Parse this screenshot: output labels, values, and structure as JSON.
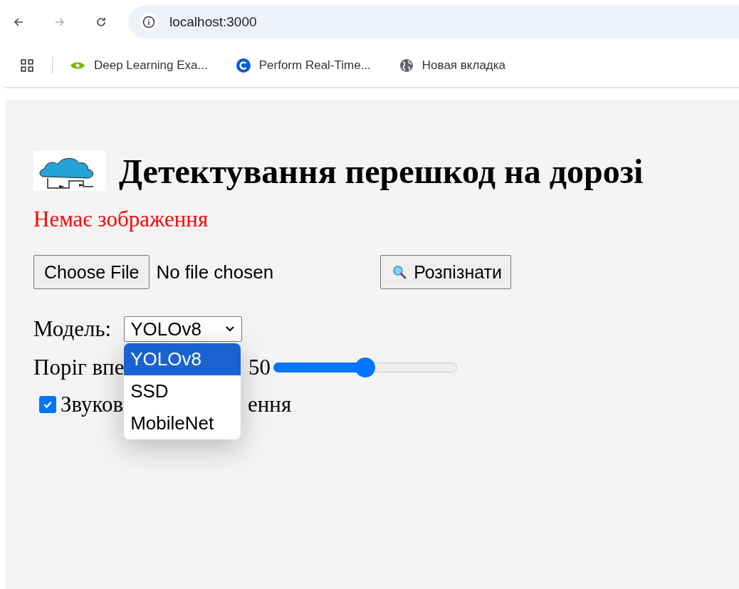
{
  "browser": {
    "address": "localhost:3000",
    "bookmarks": [
      {
        "label": "Deep Learning Exa..."
      },
      {
        "label": "Perform Real-Time..."
      },
      {
        "label": "Новая вкладка"
      }
    ]
  },
  "page": {
    "title": "Детектування перешкод на дорозі",
    "status": "Немає зображення",
    "file_button": "Choose File",
    "file_status": "No file chosen",
    "detect_button": "Розпізнати",
    "model": {
      "label": "Модель:",
      "value": "YOLOv8",
      "expanded": true,
      "options": [
        {
          "label": "YOLOv8",
          "selected": true
        },
        {
          "label": "SSD",
          "selected": false
        },
        {
          "label": "MobileNet",
          "selected": false
        }
      ]
    },
    "threshold": {
      "label": "Поріг впе",
      "reading": "50",
      "level": 0.5
    },
    "sound": {
      "label_start": "Звуков",
      "label_end": "ення",
      "checked": true
    }
  }
}
